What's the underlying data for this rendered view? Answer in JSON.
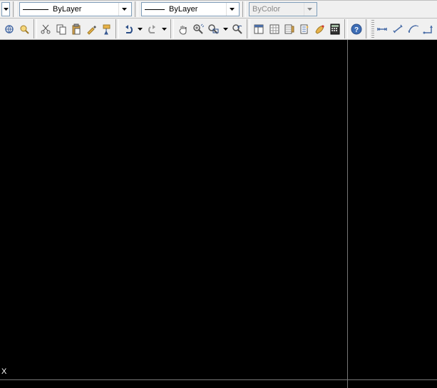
{
  "dropdowns": {
    "linetype": "ByLayer",
    "lineweight": "ByLayer",
    "plotstyle": "ByColor"
  },
  "icons": {
    "hyperlink": "⌐",
    "explorer": "◎",
    "cut": "✂",
    "copy": "⧉",
    "paste": "⧉",
    "matchprop": "🖌",
    "paintformat": "🖌",
    "undo": "↶",
    "redo": "↷",
    "pan": "✋",
    "zoomin": "🔍",
    "zoomext": "🔍",
    "zoomwin": "🔍",
    "propwin": "⊞",
    "sheet": "▦",
    "sheetset": "▦",
    "tool1": "⚙",
    "toolpal": "⧉",
    "calc": "▦",
    "help": "?",
    "dim1": "⟼",
    "dim2": "↔",
    "dim3": "⤾",
    "dim4": "⤿"
  },
  "cursor_char": "X"
}
